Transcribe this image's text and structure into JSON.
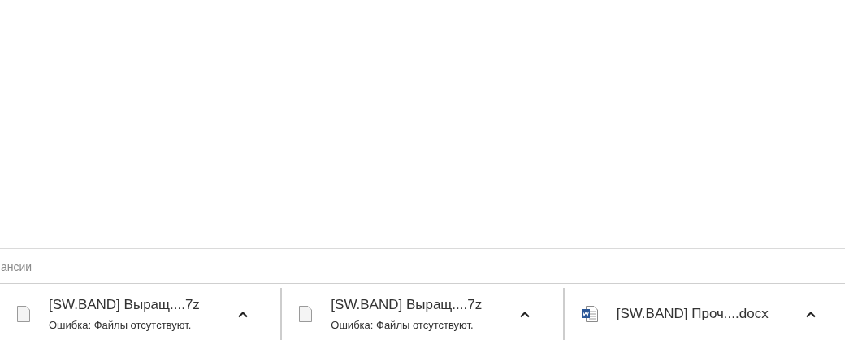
{
  "page_footer": {
    "text": "ансии"
  },
  "downloads": [
    {
      "kind": "file",
      "name": "[SW.BAND] Выращ....7z",
      "status": "Ошибка: Файлы отсутствуют."
    },
    {
      "kind": "file",
      "name": "[SW.BAND] Выращ....7z",
      "status": "Ошибка: Файлы отсутствуют."
    },
    {
      "kind": "word",
      "name": "[SW.BAND] Проч....docx"
    }
  ]
}
